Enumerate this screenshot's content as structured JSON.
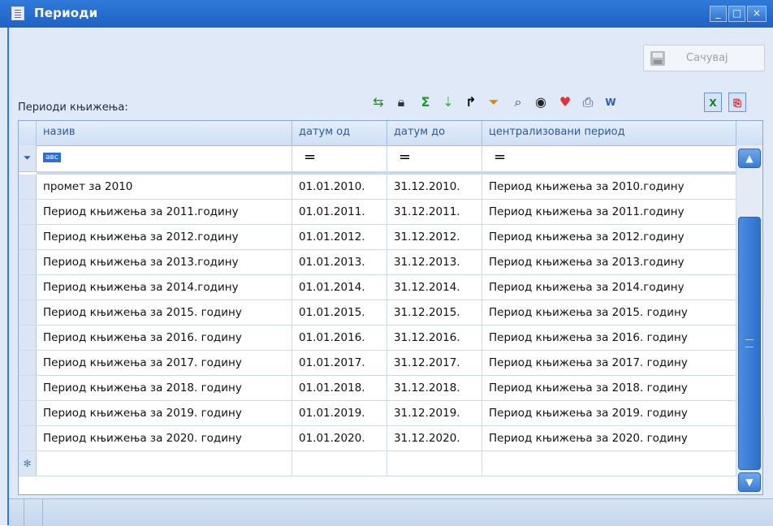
{
  "window": {
    "title": "Периоди",
    "controls": {
      "minimize": "_",
      "maximize": "□",
      "close": "×"
    }
  },
  "save_button": {
    "label": "Сачувај",
    "icon": "floppy-disk-icon",
    "enabled": false
  },
  "section_label": "Периоди књижења:",
  "toolbar_icons": [
    "refresh-icon",
    "lock-icon",
    "sum-icon",
    "expand-icon",
    "goto-icon",
    "filter-icon",
    "find-icon",
    "view-icon",
    "favorite-icon",
    "print-icon",
    "export-word-icon",
    "export-excel-icon",
    "export-pdf-icon"
  ],
  "grid": {
    "columns": [
      "назив",
      "датум од",
      "датум до",
      "централизовани период"
    ],
    "filter_row": {
      "text_filter_badge": "авс",
      "operators": [
        "=",
        "=",
        "="
      ]
    },
    "rows": [
      [
        "промет за 2010",
        "01.01.2010.",
        "31.12.2010.",
        "Период књижења за 2010.годину"
      ],
      [
        "Период књижења за 2011.годину",
        "01.01.2011.",
        "31.12.2011.",
        "Период књижења за 2011.годину"
      ],
      [
        "Период књижења за 2012.годину",
        "01.01.2012.",
        "31.12.2012.",
        "Период књижења за 2012.годину"
      ],
      [
        "Период књижења за 2013.годину",
        "01.01.2013.",
        "31.12.2013.",
        "Период књижења за 2013.годину"
      ],
      [
        "Период књижења за 2014.годину",
        "01.01.2014.",
        "31.12.2014.",
        "Период књижења за 2014.годину"
      ],
      [
        "Период књижења за 2015. годину",
        "01.01.2015.",
        "31.12.2015.",
        "Период књижења за 2015. годину"
      ],
      [
        "Период књижења за 2016. годину",
        "01.01.2016.",
        "31.12.2016.",
        "Период књижења за 2016. годину"
      ],
      [
        "Период књижења за 2017. годину",
        "01.01.2017.",
        "31.12.2017.",
        "Период књижења за 2017. годину"
      ],
      [
        "Период књижења за 2018. годину",
        "01.01.2018.",
        "31.12.2018.",
        "Период књижења за 2018. годину"
      ],
      [
        "Период књижења за 2019. годину",
        "01.01.2019.",
        "31.12.2019.",
        "Период књижења за 2019. годину"
      ],
      [
        "Период књижења за 2020. годину",
        "01.01.2020.",
        "31.12.2020.",
        "Период књижења за 2020. годину"
      ]
    ],
    "new_row_marker": "✻"
  },
  "colors": {
    "title_bar": "#2f79d9",
    "header_text": "#2a5aa0",
    "frame_bg": "#dfe9f7"
  }
}
